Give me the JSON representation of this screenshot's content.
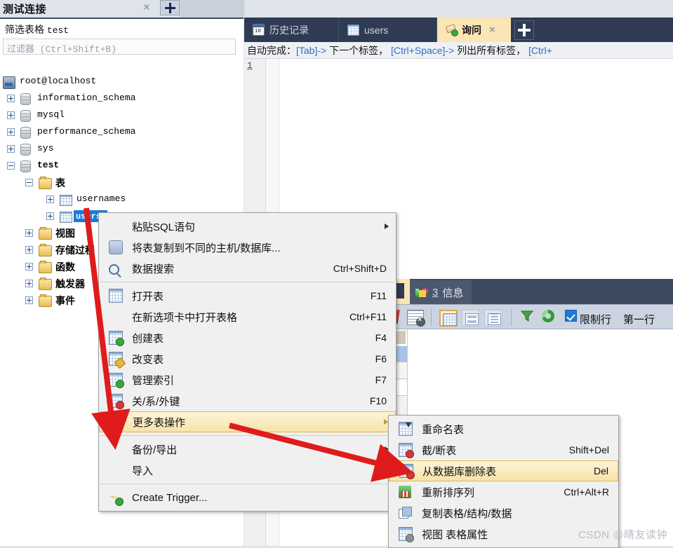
{
  "connection_tab": {
    "title": "测试连接",
    "close_icon": "close-icon",
    "new_icon": "plus-icon"
  },
  "left_panel": {
    "filter_title_prefix": "筛选表格",
    "filter_title_db": "test",
    "filter_placeholder": "过滤器 (Ctrl+Shift+B)",
    "tree": [
      {
        "label": "root@localhost",
        "icon": "server-icon",
        "indent": 0,
        "expander": "none",
        "bold": false,
        "mono": true
      },
      {
        "label": "information_schema",
        "icon": "database-icon",
        "indent": 1,
        "expander": "plus",
        "bold": false,
        "mono": true
      },
      {
        "label": "mysql",
        "icon": "database-icon",
        "indent": 1,
        "expander": "plus",
        "bold": false,
        "mono": true
      },
      {
        "label": "performance_schema",
        "icon": "database-icon",
        "indent": 1,
        "expander": "plus",
        "bold": false,
        "mono": true
      },
      {
        "label": "sys",
        "icon": "database-icon",
        "indent": 1,
        "expander": "plus",
        "bold": false,
        "mono": true
      },
      {
        "label": "test",
        "icon": "database-icon",
        "indent": 1,
        "expander": "minus",
        "bold": true,
        "mono": true
      },
      {
        "label": "表",
        "icon": "folder-icon",
        "indent": 2,
        "expander": "minus",
        "bold": true,
        "mono": false
      },
      {
        "label": "usernames",
        "icon": "table-icon",
        "indent": 3,
        "expander": "plus",
        "bold": false,
        "mono": true
      },
      {
        "label": "users",
        "icon": "table-icon",
        "indent": 3,
        "expander": "plus",
        "bold": false,
        "mono": true,
        "selected": true
      },
      {
        "label": "视图",
        "icon": "folder-icon",
        "indent": 2,
        "expander": "plus",
        "bold": true,
        "mono": false
      },
      {
        "label": "存储过程",
        "icon": "folder-icon",
        "indent": 2,
        "expander": "plus",
        "bold": true,
        "mono": false
      },
      {
        "label": "函数",
        "icon": "folder-icon",
        "indent": 2,
        "expander": "plus",
        "bold": true,
        "mono": false
      },
      {
        "label": "触发器",
        "icon": "folder-icon",
        "indent": 2,
        "expander": "plus",
        "bold": true,
        "mono": false
      },
      {
        "label": "事件",
        "icon": "folder-icon",
        "indent": 2,
        "expander": "plus",
        "bold": true,
        "mono": false
      }
    ]
  },
  "workbench": {
    "tabs": [
      {
        "label": "历史记录",
        "icon": "calendar-icon",
        "selected": false
      },
      {
        "label": "users",
        "icon": "table-icon",
        "selected": false
      },
      {
        "label": "询问",
        "icon": "query-icon",
        "selected": true,
        "closable": true
      }
    ],
    "new_tab_icon": "plus-icon",
    "autocomplete_hint": {
      "prefix": "自动完成：",
      "k1": "[Tab]->",
      "t1": " 下一个标签，",
      "k2": " [Ctrl+Space]->",
      "t2": " 列出所有标签，",
      "k3": " [Ctrl+"
    },
    "editor_line_number": "1"
  },
  "results_window": {
    "tab": {
      "label": "信息",
      "count": "3",
      "icon": "info-icon"
    },
    "toolbar": {
      "delete_row_icon": "delete-row-icon",
      "clear_icon": "clear-results-icon",
      "grid_view_icon": "grid-view-icon",
      "form_view_icon": "form-view-icon",
      "text_view_icon": "text-view-icon",
      "filter_icon": "funnel-icon",
      "refresh_icon": "refresh-icon",
      "limit_rows_label": "限制行",
      "limit_rows_checked": true,
      "first_row_label": "第一行"
    }
  },
  "context_menu": {
    "items": [
      {
        "label": "粘贴SQL语句",
        "icon": null,
        "shortcut": null,
        "submenu": true
      },
      {
        "label": "将表复制到不同的主机/数据库...",
        "icon": "copy-database-icon",
        "shortcut": null,
        "submenu": false
      },
      {
        "label": "数据搜索",
        "icon": "data-search-icon",
        "shortcut": "Ctrl+Shift+D",
        "submenu": false
      },
      {
        "separator": true
      },
      {
        "label": "打开表",
        "icon": "table-icon",
        "shortcut": "F11",
        "submenu": false
      },
      {
        "label": "在新选项卡中打开表格",
        "icon": null,
        "shortcut": "Ctrl+F11",
        "submenu": false
      },
      {
        "label": "创建表",
        "icon": "create-table-icon",
        "shortcut": "F4",
        "submenu": false
      },
      {
        "label": "改变表",
        "icon": "alter-table-icon",
        "shortcut": "F6",
        "submenu": false
      },
      {
        "label": "管理索引",
        "icon": "manage-index-icon",
        "shortcut": "F7",
        "submenu": false
      },
      {
        "label": "关/系/外键",
        "icon": "relations-icon",
        "shortcut": "F10",
        "submenu": false
      },
      {
        "label": "更多表操作",
        "icon": null,
        "shortcut": null,
        "submenu": true,
        "highlighted": true
      },
      {
        "separator": true
      },
      {
        "label": "备份/导出",
        "icon": null,
        "shortcut": null,
        "submenu": true
      },
      {
        "label": "导入",
        "icon": null,
        "shortcut": null,
        "submenu": true
      },
      {
        "separator": true
      },
      {
        "label": "Create Trigger...",
        "icon": "create-trigger-icon",
        "shortcut": null,
        "submenu": false
      }
    ]
  },
  "submenu": {
    "items": [
      {
        "label": "重命名表",
        "icon": "rename-table-icon",
        "shortcut": null
      },
      {
        "label": "截/断表",
        "icon": "truncate-table-icon",
        "shortcut": "Shift+Del"
      },
      {
        "label": "从数据库删除表",
        "icon": "drop-table-icon",
        "shortcut": "Del",
        "highlighted": true
      },
      {
        "label": "重新排序列",
        "icon": "reorder-columns-icon",
        "shortcut": "Ctrl+Alt+R"
      },
      {
        "label": "复制表格/结构/数据",
        "icon": "copy-table-icon",
        "shortcut": null
      },
      {
        "label": "视图 表格属性",
        "icon": "table-properties-icon",
        "shortcut": null
      }
    ]
  },
  "watermark": "CSDN @晴友读钟",
  "colors": {
    "accent_blue": "#1e79d6",
    "highlight_yellow": "#f7e2a8",
    "dark_chrome": "#2e3b52",
    "annotation_red": "#e01b1b"
  }
}
